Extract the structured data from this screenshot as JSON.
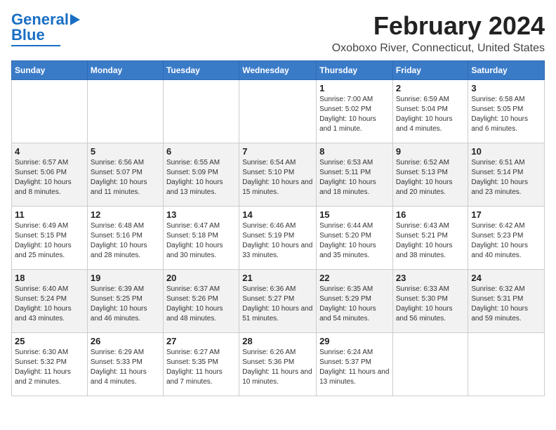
{
  "logo": {
    "line1": "General",
    "line2": "Blue"
  },
  "title": "February 2024",
  "subtitle": "Oxoboxo River, Connecticut, United States",
  "days_of_week": [
    "Sunday",
    "Monday",
    "Tuesday",
    "Wednesday",
    "Thursday",
    "Friday",
    "Saturday"
  ],
  "weeks": [
    [
      {
        "day": "",
        "info": ""
      },
      {
        "day": "",
        "info": ""
      },
      {
        "day": "",
        "info": ""
      },
      {
        "day": "",
        "info": ""
      },
      {
        "day": "1",
        "info": "Sunrise: 7:00 AM\nSunset: 5:02 PM\nDaylight: 10 hours and 1 minute."
      },
      {
        "day": "2",
        "info": "Sunrise: 6:59 AM\nSunset: 5:04 PM\nDaylight: 10 hours and 4 minutes."
      },
      {
        "day": "3",
        "info": "Sunrise: 6:58 AM\nSunset: 5:05 PM\nDaylight: 10 hours and 6 minutes."
      }
    ],
    [
      {
        "day": "4",
        "info": "Sunrise: 6:57 AM\nSunset: 5:06 PM\nDaylight: 10 hours and 8 minutes."
      },
      {
        "day": "5",
        "info": "Sunrise: 6:56 AM\nSunset: 5:07 PM\nDaylight: 10 hours and 11 minutes."
      },
      {
        "day": "6",
        "info": "Sunrise: 6:55 AM\nSunset: 5:09 PM\nDaylight: 10 hours and 13 minutes."
      },
      {
        "day": "7",
        "info": "Sunrise: 6:54 AM\nSunset: 5:10 PM\nDaylight: 10 hours and 15 minutes."
      },
      {
        "day": "8",
        "info": "Sunrise: 6:53 AM\nSunset: 5:11 PM\nDaylight: 10 hours and 18 minutes."
      },
      {
        "day": "9",
        "info": "Sunrise: 6:52 AM\nSunset: 5:13 PM\nDaylight: 10 hours and 20 minutes."
      },
      {
        "day": "10",
        "info": "Sunrise: 6:51 AM\nSunset: 5:14 PM\nDaylight: 10 hours and 23 minutes."
      }
    ],
    [
      {
        "day": "11",
        "info": "Sunrise: 6:49 AM\nSunset: 5:15 PM\nDaylight: 10 hours and 25 minutes."
      },
      {
        "day": "12",
        "info": "Sunrise: 6:48 AM\nSunset: 5:16 PM\nDaylight: 10 hours and 28 minutes."
      },
      {
        "day": "13",
        "info": "Sunrise: 6:47 AM\nSunset: 5:18 PM\nDaylight: 10 hours and 30 minutes."
      },
      {
        "day": "14",
        "info": "Sunrise: 6:46 AM\nSunset: 5:19 PM\nDaylight: 10 hours and 33 minutes."
      },
      {
        "day": "15",
        "info": "Sunrise: 6:44 AM\nSunset: 5:20 PM\nDaylight: 10 hours and 35 minutes."
      },
      {
        "day": "16",
        "info": "Sunrise: 6:43 AM\nSunset: 5:21 PM\nDaylight: 10 hours and 38 minutes."
      },
      {
        "day": "17",
        "info": "Sunrise: 6:42 AM\nSunset: 5:23 PM\nDaylight: 10 hours and 40 minutes."
      }
    ],
    [
      {
        "day": "18",
        "info": "Sunrise: 6:40 AM\nSunset: 5:24 PM\nDaylight: 10 hours and 43 minutes."
      },
      {
        "day": "19",
        "info": "Sunrise: 6:39 AM\nSunset: 5:25 PM\nDaylight: 10 hours and 46 minutes."
      },
      {
        "day": "20",
        "info": "Sunrise: 6:37 AM\nSunset: 5:26 PM\nDaylight: 10 hours and 48 minutes."
      },
      {
        "day": "21",
        "info": "Sunrise: 6:36 AM\nSunset: 5:27 PM\nDaylight: 10 hours and 51 minutes."
      },
      {
        "day": "22",
        "info": "Sunrise: 6:35 AM\nSunset: 5:29 PM\nDaylight: 10 hours and 54 minutes."
      },
      {
        "day": "23",
        "info": "Sunrise: 6:33 AM\nSunset: 5:30 PM\nDaylight: 10 hours and 56 minutes."
      },
      {
        "day": "24",
        "info": "Sunrise: 6:32 AM\nSunset: 5:31 PM\nDaylight: 10 hours and 59 minutes."
      }
    ],
    [
      {
        "day": "25",
        "info": "Sunrise: 6:30 AM\nSunset: 5:32 PM\nDaylight: 11 hours and 2 minutes."
      },
      {
        "day": "26",
        "info": "Sunrise: 6:29 AM\nSunset: 5:33 PM\nDaylight: 11 hours and 4 minutes."
      },
      {
        "day": "27",
        "info": "Sunrise: 6:27 AM\nSunset: 5:35 PM\nDaylight: 11 hours and 7 minutes."
      },
      {
        "day": "28",
        "info": "Sunrise: 6:26 AM\nSunset: 5:36 PM\nDaylight: 11 hours and 10 minutes."
      },
      {
        "day": "29",
        "info": "Sunrise: 6:24 AM\nSunset: 5:37 PM\nDaylight: 11 hours and 13 minutes."
      },
      {
        "day": "",
        "info": ""
      },
      {
        "day": "",
        "info": ""
      }
    ]
  ]
}
